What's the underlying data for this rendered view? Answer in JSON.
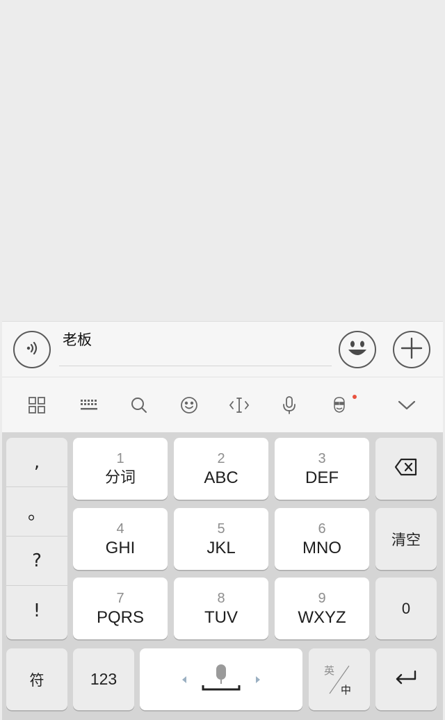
{
  "input_bar": {
    "text_value": "老板",
    "voice_icon": "voice-wave-icon",
    "emoji_icon": "smiley-face-icon",
    "plus_icon": "plus-icon"
  },
  "toolbar": {
    "icons": [
      "grid-icon",
      "keyboard-icon",
      "search-icon",
      "emoji-icon",
      "text-cursor-icon",
      "microphone-icon",
      "avatar-skin-icon",
      "chevron-down-icon"
    ],
    "notification_dot_color": "#e8533f"
  },
  "keyboard": {
    "punctuation": [
      ",",
      "。",
      "?",
      "!"
    ],
    "keys": [
      {
        "num": "1",
        "label": "分词"
      },
      {
        "num": "2",
        "label": "ABC"
      },
      {
        "num": "3",
        "label": "DEF"
      },
      {
        "num": "4",
        "label": "GHI"
      },
      {
        "num": "5",
        "label": "JKL"
      },
      {
        "num": "6",
        "label": "MNO"
      },
      {
        "num": "7",
        "label": "PQRS"
      },
      {
        "num": "8",
        "label": "TUV"
      },
      {
        "num": "9",
        "label": "WXYZ"
      }
    ],
    "clear_label": "清空",
    "zero_label": "0",
    "symbol_label": "符",
    "numeric_label": "123",
    "lang_top": "英",
    "lang_bottom": "中",
    "backspace_icon": "backspace-icon",
    "enter_icon": "enter-icon",
    "space_mic_icon": "microphone-icon"
  },
  "colors": {
    "background": "#ececec",
    "key_white": "#ffffff",
    "key_gray": "#ececec",
    "keyboard_bg": "#d5d5d5"
  }
}
